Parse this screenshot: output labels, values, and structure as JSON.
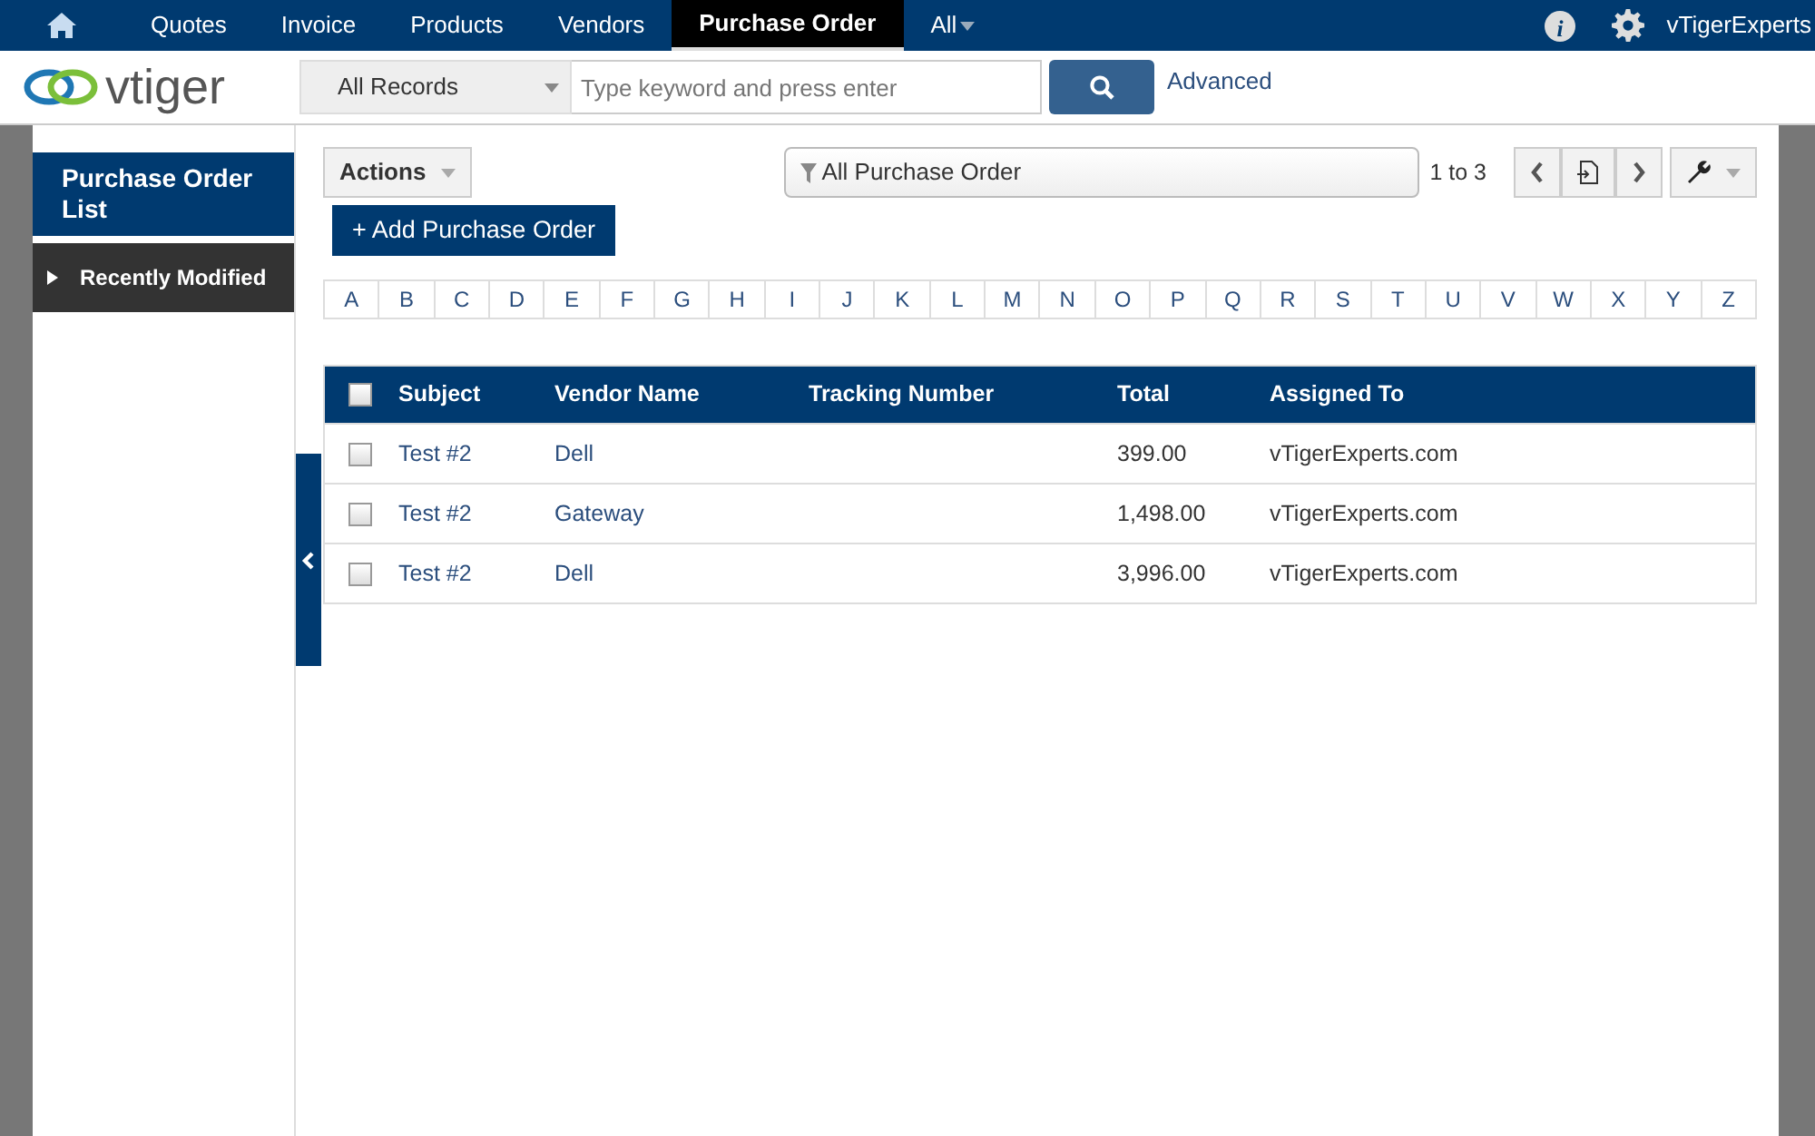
{
  "top_nav": {
    "items": [
      {
        "label": "Quotes",
        "selected": false
      },
      {
        "label": "Invoice",
        "selected": false
      },
      {
        "label": "Products",
        "selected": false
      },
      {
        "label": "Vendors",
        "selected": false
      },
      {
        "label": "Purchase Order",
        "selected": true
      },
      {
        "label": "All",
        "selected": false
      }
    ],
    "user": "vTigerExperts",
    "info": "i"
  },
  "logo": "vtiger",
  "search_bar": {
    "scope": "All Records",
    "placeholder": "Type keyword and press enter",
    "advanced": "Advanced"
  },
  "sidebar": {
    "title": "Purchase Order List",
    "items": [
      {
        "label": "Recently Modified",
        "expanded": false
      }
    ]
  },
  "toolbar": {
    "actions": "Actions",
    "add_button": "+ Add Purchase Order",
    "filter": "All Purchase Order",
    "page_info": "1 to 3"
  },
  "alphabet": [
    "A",
    "B",
    "C",
    "D",
    "E",
    "F",
    "G",
    "H",
    "I",
    "J",
    "K",
    "L",
    "M",
    "N",
    "O",
    "P",
    "Q",
    "R",
    "S",
    "T",
    "U",
    "V",
    "W",
    "X",
    "Y",
    "Z"
  ],
  "table": {
    "columns": [
      "Subject",
      "Vendor Name",
      "Tracking Number",
      "Total",
      "Assigned To"
    ],
    "select_all_checked": false,
    "rows": [
      {
        "checked": false,
        "cells": [
          "Test #2",
          "Dell",
          "",
          "399.00",
          "vTigerExperts.com"
        ]
      },
      {
        "checked": false,
        "cells": [
          "Test #2",
          "Gateway",
          "",
          "1,498.00",
          "vTigerExperts.com"
        ]
      },
      {
        "checked": false,
        "cells": [
          "Test #2",
          "Dell",
          "",
          "3,996.00",
          "vTigerExperts.com"
        ]
      }
    ]
  }
}
